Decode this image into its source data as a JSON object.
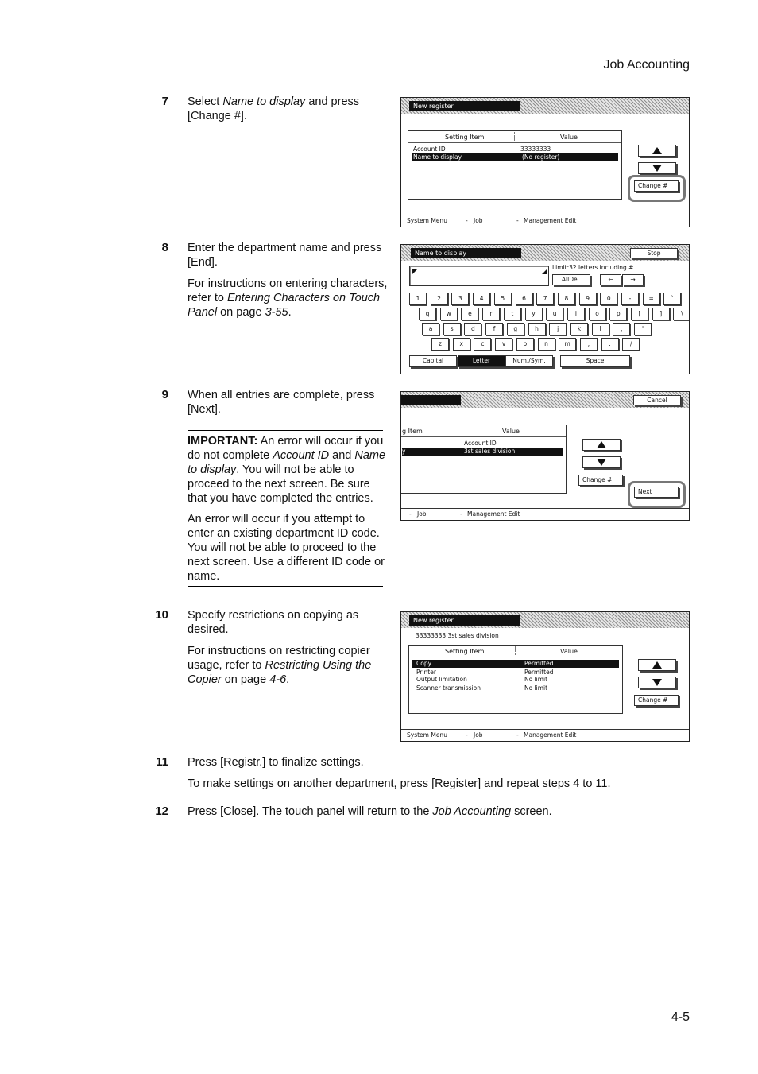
{
  "header": {
    "title": "Job Accounting"
  },
  "footer": {
    "page_number": "4-5"
  },
  "steps": [
    {
      "number": "7",
      "text": [
        "Select ",
        {
          "i": "Name to display"
        },
        " and press [Change #]."
      ]
    },
    {
      "number": "8",
      "text": [
        "Enter the department name and press [End]."
      ],
      "note": [
        "For instructions on entering characters, refer to ",
        {
          "i": "Entering Characters on Touch Panel"
        },
        " on page ",
        {
          "i": "3-55"
        },
        "."
      ]
    },
    {
      "number": "9",
      "text": [
        "When all entries are complete, press [Next]."
      ],
      "important": [
        {
          "b": "IMPORTANT:"
        },
        " An error will occur if you do not complete ",
        {
          "i": "Account ID"
        },
        " and ",
        {
          "i": "Name to display"
        },
        ". You will not be able to proceed to the next screen. Be sure that you have completed the entries."
      ],
      "error_note": "An error will occur if you attempt to enter an existing department ID code. You will not be able to proceed to the next screen. Use a different ID code or name."
    },
    {
      "number": "10",
      "text": [
        "Specify restrictions on copying as desired."
      ],
      "note": [
        "For instructions on restricting copier usage, refer to ",
        {
          "i": "Restricting Using the Copier"
        },
        " on page ",
        {
          "i": "4-6"
        },
        "."
      ]
    },
    {
      "number": "11",
      "text": [
        "Press [Registr.] to finalize settings."
      ],
      "note": [
        "To make settings on another department, press [Register] and repeat steps 4 to 11."
      ]
    },
    {
      "number": "12",
      "text": [
        "Press [Close]. The touch panel will return to the ",
        {
          "i": "Job Accounting"
        },
        " screen."
      ]
    }
  ],
  "screen1": {
    "title": "New register",
    "col_setting": "Setting Item",
    "col_value": "Value",
    "rows": [
      {
        "item": "Account ID",
        "value": "33333333"
      },
      {
        "item": "Name to display",
        "value": "(No register)"
      }
    ],
    "change_btn": "Change #",
    "crumbs": [
      "System Menu",
      "-",
      "Job",
      "-",
      "Management Edit"
    ]
  },
  "screen2": {
    "title": "Name to display",
    "stop_btn": "Stop",
    "limit_text": "Limit:32 letters including #",
    "alldel_btn": "AllDel.",
    "row1": [
      "1",
      "2",
      "3",
      "4",
      "5",
      "6",
      "7",
      "8",
      "9",
      "0",
      "-",
      "=",
      "`"
    ],
    "row2": [
      "q",
      "w",
      "e",
      "r",
      "t",
      "y",
      "u",
      "i",
      "o",
      "p",
      "[",
      "]",
      "\\"
    ],
    "row3": [
      "a",
      "s",
      "d",
      "f",
      "g",
      "h",
      "j",
      "k",
      "l",
      ";",
      "'"
    ],
    "row4": [
      "z",
      "x",
      "c",
      "v",
      "b",
      "n",
      "m",
      ",",
      ".",
      "/"
    ],
    "mode_capital": "Capital",
    "mode_letter": "Letter",
    "mode_num": "Num./Sym.",
    "mode_space": "Space"
  },
  "screen3": {
    "cancel_btn": "Cancel",
    "col_setting": "g Item",
    "col_value": "Value",
    "rows": [
      {
        "item": "",
        "value": "Account ID"
      },
      {
        "item": "y",
        "value": "3st sales division"
      }
    ],
    "change_btn": "Change #",
    "next_btn": "Next",
    "crumbs": [
      "-",
      "Job",
      "-",
      "Management Edit"
    ]
  },
  "screen4": {
    "title": "New register",
    "subtitle": "33333333 3st sales division",
    "col_setting": "Setting Item",
    "col_value": "Value",
    "rows": [
      {
        "item": "Copy",
        "value": "Permitted"
      },
      {
        "item": "Printer",
        "value": "Permitted"
      },
      {
        "item": "Output limitation",
        "value": "No limit"
      },
      {
        "item": "Scanner transmission",
        "value": "No limit"
      }
    ],
    "change_btn": "Change #",
    "crumbs": [
      "System Menu",
      "-",
      "Job",
      "-",
      "Management Edit"
    ]
  }
}
